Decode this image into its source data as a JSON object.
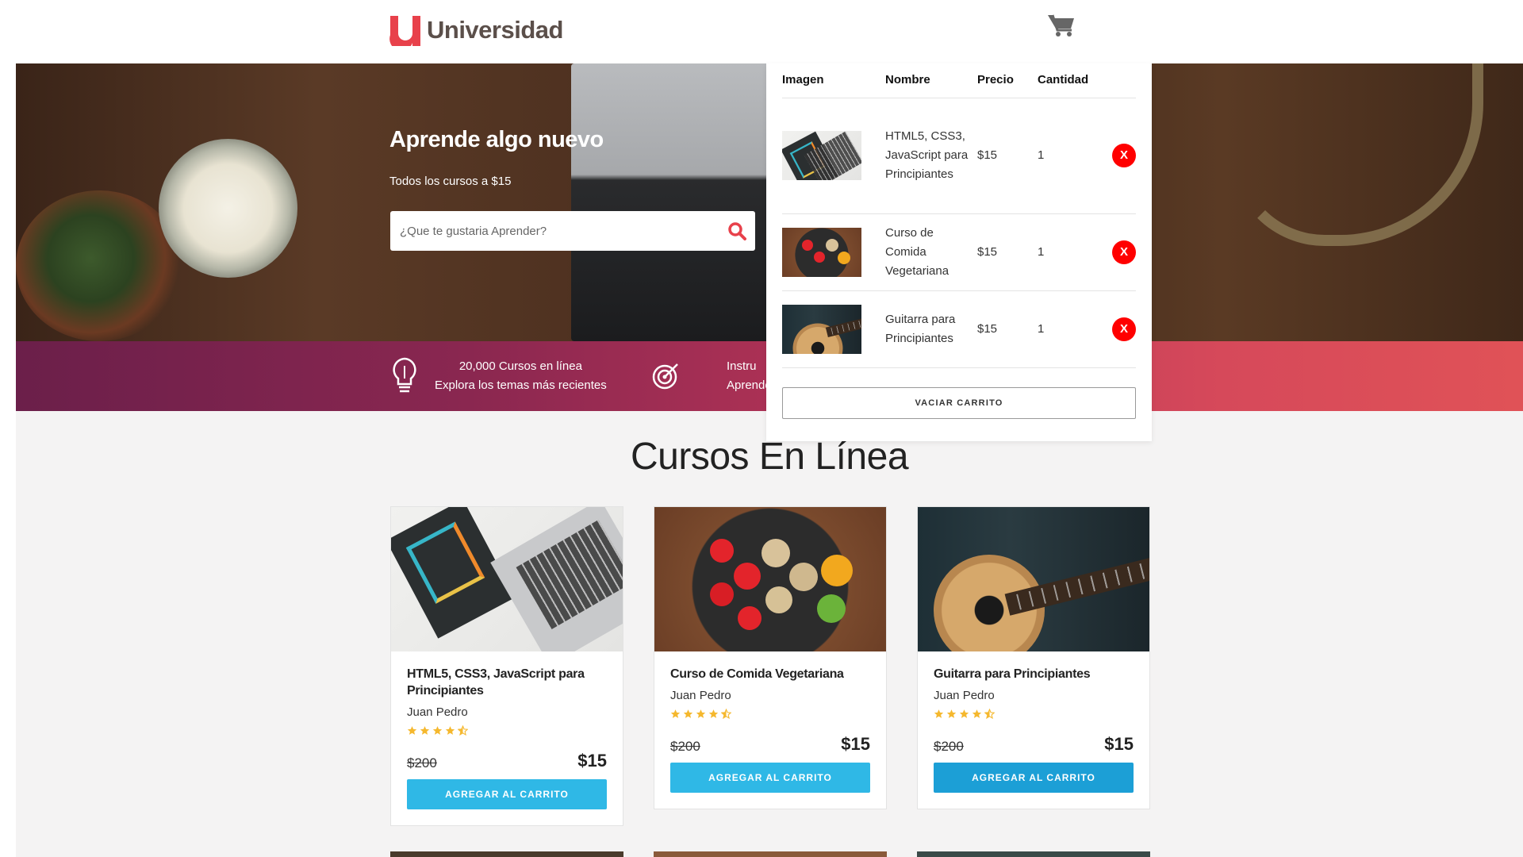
{
  "header": {
    "brand": "Universidad",
    "cart_icon": "shopping-cart-icon"
  },
  "hero": {
    "title": "Aprende algo nuevo",
    "subtitle": "Todos los cursos a $15",
    "search_placeholder": "¿Que te gustaria Aprender?",
    "search_icon": "search-icon"
  },
  "features": [
    {
      "icon": "lightbulb-icon",
      "line1": "20,000 Cursos en línea",
      "line2": "Explora los temas más recientes"
    },
    {
      "icon": "target-icon",
      "line1": "Instru",
      "line2": "Aprende"
    }
  ],
  "section_title": "Cursos En Línea",
  "courses": [
    {
      "name": "HTML5, CSS3, JavaScript para Principiantes",
      "author": "Juan Pedro",
      "rating": 4.5,
      "old_price": "$200",
      "price": "$15",
      "button": "AGREGAR AL CARRITO"
    },
    {
      "name": "Curso de Comida Vegetariana",
      "author": "Juan Pedro",
      "rating": 4.5,
      "old_price": "$200",
      "price": "$15",
      "button": "AGREGAR AL CARRITO"
    },
    {
      "name": "Guitarra para Principiantes",
      "author": "Juan Pedro",
      "rating": 4.5,
      "old_price": "$200",
      "price": "$15",
      "button": "AGREGAR AL CARRITO"
    }
  ],
  "cart": {
    "headers": {
      "image": "Imagen",
      "name": "Nombre",
      "price": "Precio",
      "qty": "Cantidad"
    },
    "items": [
      {
        "name": "HTML5, CSS3, JavaScript para Principiantes",
        "price": "$15",
        "qty": "1",
        "remove": "X"
      },
      {
        "name": "Curso de Comida Vegetariana",
        "price": "$15",
        "qty": "1",
        "remove": "X"
      },
      {
        "name": "Guitarra para Principiantes",
        "price": "$15",
        "qty": "1",
        "remove": "X"
      }
    ],
    "empty_button": "VACIAR CARRITO"
  },
  "colors": {
    "brand_red": "#e8414b",
    "button_blue": "#2fb8e6",
    "remove_red": "#ff0000",
    "star": "#f5b82e"
  }
}
